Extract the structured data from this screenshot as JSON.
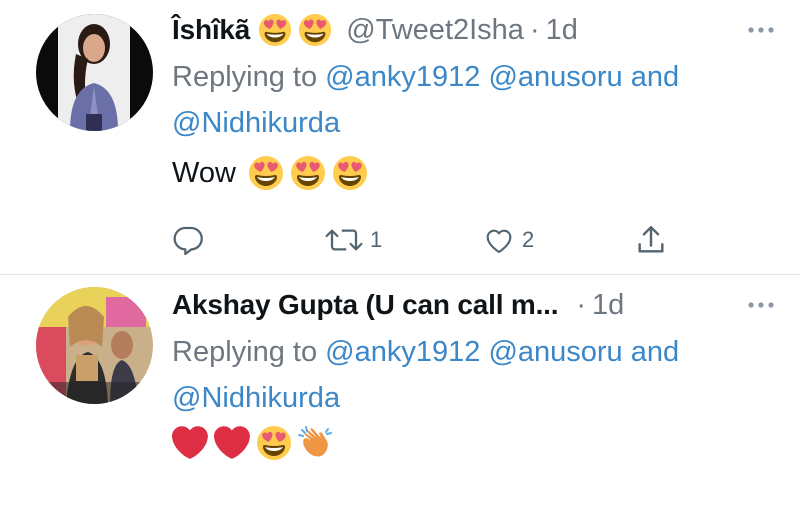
{
  "tweets": [
    {
      "name": "Îshîkã",
      "handle": "@Tweet2Isha",
      "time": "1d",
      "replying_prefix": "Replying to",
      "mentions": [
        "@anky1912",
        "@anusoru"
      ],
      "and_word": "and",
      "mention_last": "@Nidhikurda",
      "text": "Wow",
      "reply_count": "",
      "retweet_count": "1",
      "like_count": "2"
    },
    {
      "name": "Akshay Gupta (U can call m...",
      "time": "1d",
      "replying_prefix": "Replying to",
      "mentions": [
        "@anky1912",
        "@anusoru"
      ],
      "and_word": "and",
      "mention_last": "@Nidhikurda"
    }
  ],
  "dot": "·",
  "icons": {
    "more": "more-horizontal-icon",
    "reply": "reply-icon",
    "retweet": "retweet-icon",
    "like": "heart-icon",
    "share": "share-icon",
    "emoji_heart_eyes": "heart-eyes-emoji",
    "emoji_red_heart": "red-heart-emoji",
    "emoji_clap": "clapping-hands-emoji"
  },
  "colors": {
    "link": "#3b87c8",
    "secondary": "#6e7781",
    "divider": "#dfe3e6"
  }
}
